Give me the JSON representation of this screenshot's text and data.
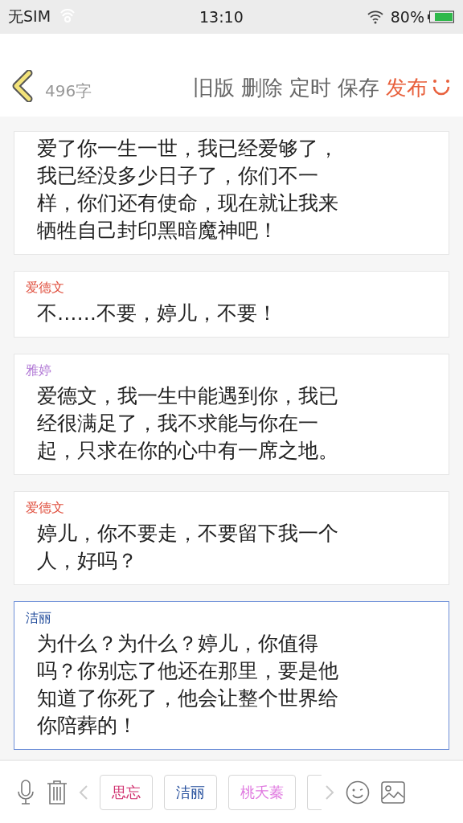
{
  "status_bar": {
    "carrier": "无SIM",
    "time": "13:10",
    "battery": "80%"
  },
  "header": {
    "word_count": "496字",
    "actions": [
      {
        "label": "旧版",
        "kind": "plain"
      },
      {
        "label": "删除",
        "kind": "plain"
      },
      {
        "label": "定时",
        "kind": "plain"
      },
      {
        "label": "保存",
        "kind": "plain"
      },
      {
        "label": "发布",
        "kind": "primary"
      }
    ]
  },
  "dialogues": [
    {
      "text": "爱了你一生一世，我已经爱够了，我已经没多少日子了，你们不一样，你们还有使命，现在就让我来牺牲自己封印黑暗魔神吧！",
      "selected": false
    },
    {
      "speaker": "爱德文",
      "color": "#e0503f",
      "text": "不……不要，婷儿，不要！",
      "selected": false
    },
    {
      "speaker": "雅婷",
      "color": "#b27ad6",
      "text": "爱德文，我一生中能遇到你，我已经很满足了，我不求能与你在一起，只求在你的心中有一席之地。",
      "selected": false
    },
    {
      "speaker": "爱德文",
      "color": "#e0503f",
      "text": "婷儿，你不要走，不要留下我一个人，好吗？",
      "selected": false
    },
    {
      "speaker": "洁丽",
      "color": "#1f4a9a",
      "text": "为什么？为什么？婷儿，你值得吗？你别忘了他还在那里，要是他知道了你死了，他会让整个世界给你陪葬的！",
      "selected": true
    }
  ],
  "characters": [
    {
      "name": "思忘",
      "color": "#d0306e"
    },
    {
      "name": "洁丽",
      "color": "#1f4a9a"
    },
    {
      "name": "桃夭蓁",
      "color": "#e07ae0"
    }
  ]
}
